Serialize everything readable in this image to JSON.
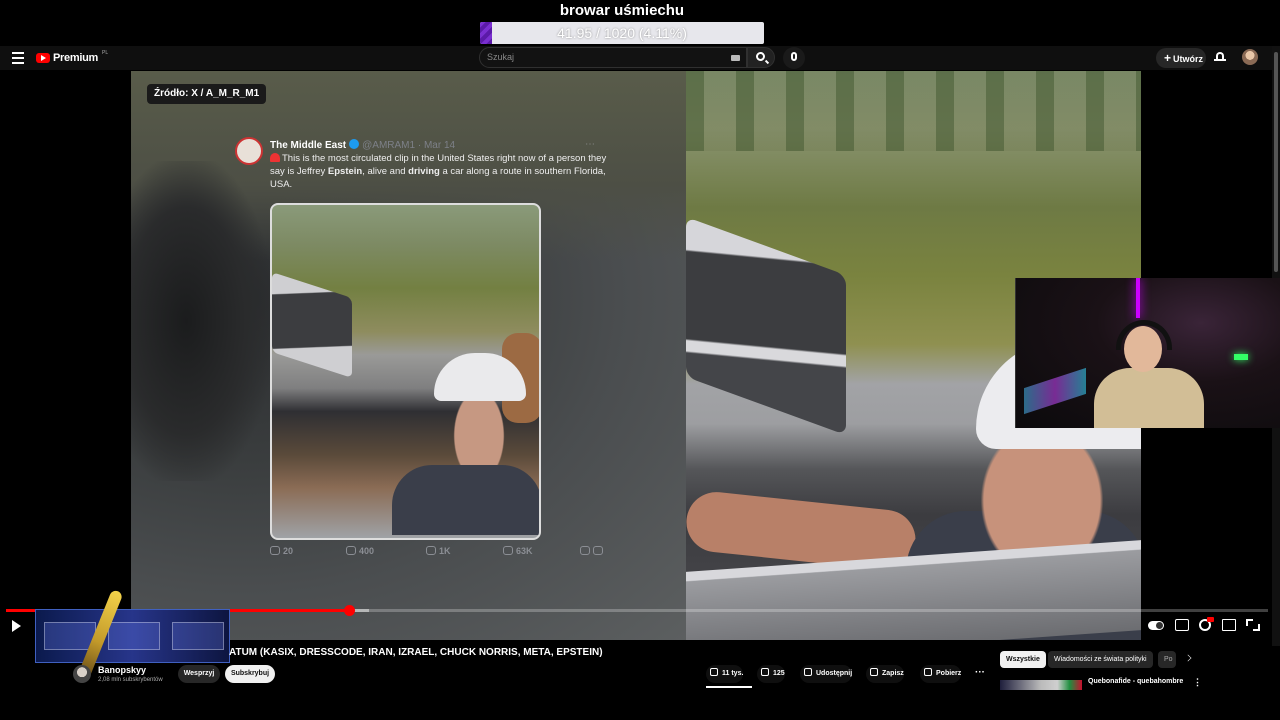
{
  "overlay": {
    "goal_title": "browar uśmiechu",
    "goal_progress_text": "41.95 / 1020 (4.11%)",
    "goal_fraction": 0.0411,
    "fill_color": "#6a24bc"
  },
  "topbar": {
    "logo_text": "Premium",
    "logo_sup": "PL",
    "search_placeholder": "Szukaj",
    "create_label": "Utwórz"
  },
  "video": {
    "source_label": "Źródło: X / A_M_R_M1",
    "tweet": {
      "name": "The Middle East",
      "handle": "@AMRAM1 · Mar 14",
      "text_a": "This is the most circulated clip in the United States right now of a person they say is Jeffrey ",
      "text_bold1": "Epstein",
      "text_b": ", alive and ",
      "text_bold2": "driving",
      "text_c": " a car along a route in southern Florida, USA.",
      "replies": "20",
      "reposts": "400",
      "likes": "1K",
      "views": "63K"
    }
  },
  "player": {
    "played_fraction": 0.272,
    "buffered_fraction": 0.288,
    "accent": "#ff0000"
  },
  "below": {
    "title": "ATUM (KASIX, DRESSCODE, IRAN, IZRAEL, CHUCK NORRIS, META, EPSTEIN)",
    "channel_name": "Banopskyy",
    "channel_subs": "2,08 mln subskrybentów",
    "join_label": "Wesprzyj",
    "subscribe_label": "Subskrybuj",
    "likes_label": "11 tys.",
    "dislikes_label": "125",
    "share_label": "Udostępnij",
    "save_label": "Zapisz",
    "download_label": "Pobierz"
  },
  "sidebar": {
    "chips": [
      "Wszystkie",
      "Wiadomości ze świata polityki",
      "Po"
    ],
    "rec_title": "Quebonafide - quebahombre"
  }
}
